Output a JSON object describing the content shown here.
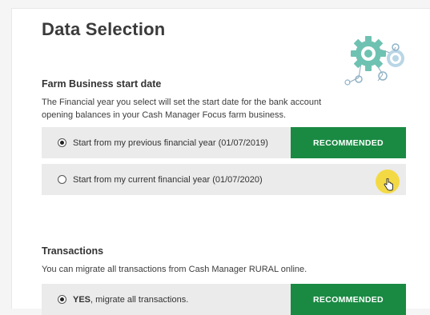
{
  "page": {
    "title": "Data Selection"
  },
  "farm_business": {
    "heading": "Farm Business start date",
    "description": "The Financial year you select will set the start date for the bank account opening balances in your Cash Manager Focus farm business.",
    "options": [
      {
        "label": "Start from my previous financial year (01/07/2019)",
        "selected": true,
        "badge": "RECOMMENDED"
      },
      {
        "label": "Start from my current financial year (01/07/2020)",
        "selected": false
      }
    ]
  },
  "transactions": {
    "heading": "Transactions",
    "description": "You can migrate all transactions from Cash Manager RURAL online.",
    "options": [
      {
        "label_bold": "YES",
        "label_rest": ", migrate all transactions.",
        "selected": true,
        "badge": "RECOMMENDED"
      }
    ]
  },
  "colors": {
    "accent_green": "#1a8a43",
    "gear_teal": "#5bb7a7",
    "cursor_highlight": "#f5d728"
  },
  "icons": {
    "illustration": "gears-icon",
    "cursor": "hand-pointer-icon"
  }
}
